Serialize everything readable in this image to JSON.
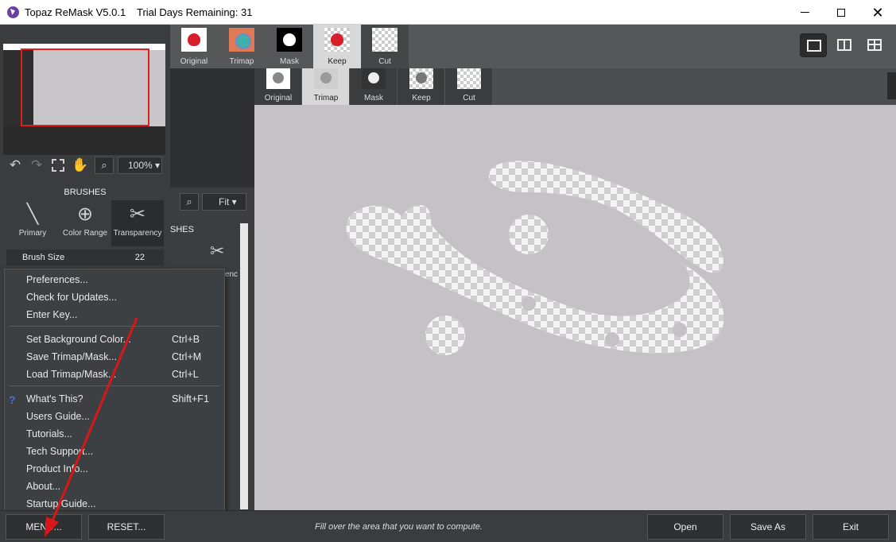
{
  "window": {
    "app_title": "Topaz ReMask V5.0.1",
    "trial_text": "Trial Days Remaining: 31"
  },
  "top_tabs": [
    {
      "label": "Original",
      "icon": "apple-original-icon"
    },
    {
      "label": "Trimap",
      "icon": "apple-trimap-icon"
    },
    {
      "label": "Mask",
      "icon": "apple-mask-icon"
    },
    {
      "label": "Keep",
      "icon": "apple-keep-icon",
      "selected": true
    },
    {
      "label": "Cut",
      "icon": "apple-cut-icon"
    }
  ],
  "sub_tabs": [
    {
      "label": "Original"
    },
    {
      "label": "Trimap",
      "selected": true
    },
    {
      "label": "Mask"
    },
    {
      "label": "Keep"
    },
    {
      "label": "Cut"
    }
  ],
  "left_panel": {
    "zoom_value": "100%",
    "brushes_title": "BRUSHES",
    "brushes": [
      {
        "label": "Primary"
      },
      {
        "label": "Color Range"
      },
      {
        "label": "Transparency",
        "active": true
      }
    ],
    "brush_size_label": "Brush Size",
    "brush_size_value": "22"
  },
  "mid_panel": {
    "zoom_fit": "Fit",
    "brushes_partial": "SHES",
    "transparency_partial": "arenc"
  },
  "menu": {
    "items_group1": [
      "Preferences...",
      "Check for Updates...",
      "Enter Key..."
    ],
    "items_group2": [
      {
        "label": "Set Background Color...",
        "shortcut": "Ctrl+B"
      },
      {
        "label": "Save Trimap/Mask...",
        "shortcut": "Ctrl+M"
      },
      {
        "label": "Load Trimap/Mask...",
        "shortcut": "Ctrl+L"
      }
    ],
    "items_group3": [
      {
        "label": "What's This?",
        "shortcut": "Shift+F1"
      },
      {
        "label": "Users Guide..."
      },
      {
        "label": "Tutorials..."
      },
      {
        "label": "Tech Support..."
      },
      {
        "label": "Product Info..."
      },
      {
        "label": "About..."
      },
      {
        "label": "Startup Guide..."
      }
    ]
  },
  "bottom_bar": {
    "menu_label": "MENU...",
    "reset_label": "RESET...",
    "status_text": "Fill over the area that you want to compute.",
    "open_label": "Open",
    "save_as_label": "Save As",
    "exit_label": "Exit"
  },
  "colors": {
    "accent_red": "#e02020",
    "panel_bg": "#3a3c3e",
    "canvas_bg": "#c4c2c4"
  }
}
